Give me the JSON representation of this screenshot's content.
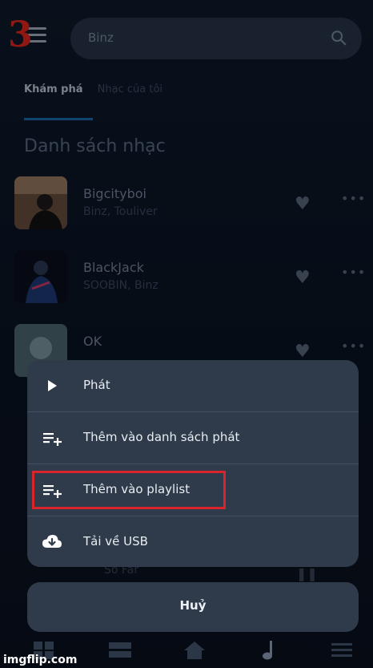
{
  "step_marker": "3",
  "search": {
    "value": "Binz"
  },
  "tabs": [
    {
      "label": "Khám phá",
      "active": true
    },
    {
      "label": "Nhạc của tôi",
      "active": false
    }
  ],
  "section_title": "Danh sách nhạc",
  "songs": [
    {
      "title": "Bigcityboi",
      "artist": "Binz, Touliver"
    },
    {
      "title": "BlackJack",
      "artist": "SOOBIN, Binz"
    },
    {
      "title": "OK",
      "artist": ""
    }
  ],
  "mini_player": {
    "subtitle": "So Far"
  },
  "action_sheet": {
    "items": [
      {
        "label": "Phát",
        "icon": "play-icon"
      },
      {
        "label": "Thêm vào danh sách phát",
        "icon": "queue-add-icon"
      },
      {
        "label": "Thêm vào playlist",
        "icon": "playlist-add-icon",
        "highlighted": true
      },
      {
        "label": "Tải về USB",
        "icon": "cloud-download-icon"
      }
    ],
    "cancel_label": "Huỷ"
  },
  "bottom_nav": [
    "grid-icon",
    "library-icon",
    "home-icon",
    "music-note-icon",
    "menu-icon"
  ],
  "watermark": "imgflip.com",
  "colors": {
    "highlight_border": "#d8242a",
    "tab_underline": "#1e6fb8",
    "sheet_bg": "#2f3a4a"
  }
}
